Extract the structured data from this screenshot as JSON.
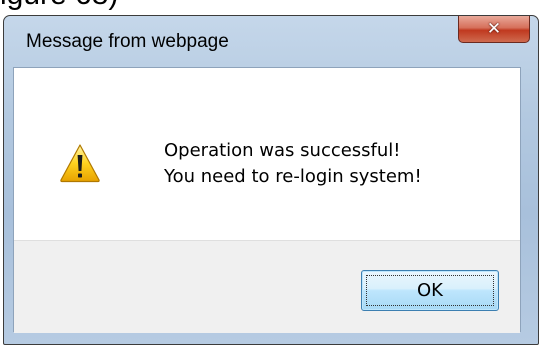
{
  "background_text": "igure 68)",
  "dialog": {
    "title": "Message from webpage",
    "close_icon": "close-icon",
    "icon": "warning-icon",
    "message_lines": [
      "Operation was successful!",
      "You need to re-login system!"
    ],
    "ok_label": "OK"
  },
  "colors": {
    "close_button": "#c0391f",
    "ok_button_border": "#3c7fb1",
    "warning_yellow": "#ffd21f"
  }
}
